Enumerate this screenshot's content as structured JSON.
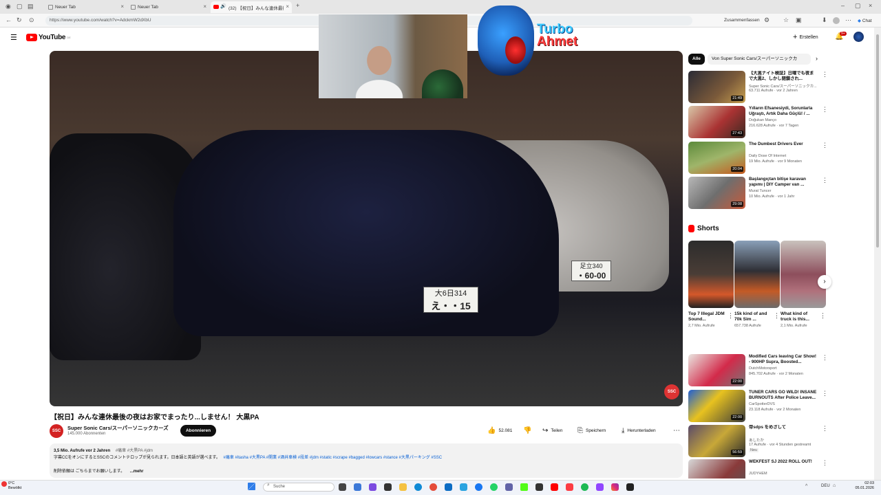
{
  "browser": {
    "tabs": [
      {
        "title": "Neuer Tab"
      },
      {
        "title": "Neuer Tab"
      },
      {
        "title": "(32) 【祝日】みんな連休最後の..."
      }
    ],
    "url": "https://www.youtube.com/watch?v=AdckmW2dXbU",
    "right_label": "Zusammenfassen",
    "chat_label": "Chat"
  },
  "youtube": {
    "logo_text": "YouTube",
    "logo_region": "DE",
    "create_label": "Erstellen",
    "notif_count": "9+",
    "video": {
      "title": "【祝日】みんな連休最後の夜はお家でまったり...しません！ 大黒PA",
      "plate1_line1": "大6日314",
      "plate1_line2": "え・・15",
      "plate2_line1": "足立340",
      "plate2_line2": "・60-00",
      "watermark": "SSC"
    },
    "channel": {
      "avatar_text": "SSC",
      "name": "Super Sonic Cars/スーパーソニックカーズ",
      "subscribers": "145.000 Abonnenten",
      "subscribe_label": "Abonnieren"
    },
    "actions": {
      "likes": "52.081",
      "share": "Teilen",
      "save": "Speichern",
      "download": "Herunterladen"
    },
    "description": {
      "stats": "3,5 Mio. Aufrufe  vor 2 Jahren",
      "stat_tags": "#痛車 #大黒PA #jdm",
      "line2": "字幕CCをオンにするとSSCのコメントテロップが見られます。日本語と英語が選べます。",
      "line2_tags": "#痛車 #itasha #大黒PA #開業 #酒井車検 #段差 #jdm #static #scrape #bagged #lowcars #stance #大黒パーキング #SSC",
      "line3": "削除依頼は ごちらまでお願いします。",
      "more": "...mehr"
    },
    "chips": [
      {
        "label": "Alle",
        "active": true
      },
      {
        "label": "Von Super Sonic Cars/スーパーソニックカ",
        "active": false
      }
    ],
    "related": [
      {
        "title": "【大黒ナイト検証】日曜でも夜まで大黒2、しかし閉鎖され...",
        "channel": "Super Sonic Cars/スーパーソニックカ...",
        "meta": "63.711 Aufrufe · vor 2 Jahren",
        "duration": "21:49"
      },
      {
        "title": "Yılların Efsanesiydi, Sorunlarla Uğraştı, Artık Daha Güçlü! / ...",
        "channel": "Doğukan Manço",
        "meta": "216.628 Aufrufe · vor 7 Tagen",
        "duration": "27:43"
      },
      {
        "title": "The Dumbest Drivers Ever",
        "channel": "Daily Dose Of Internet",
        "meta": "19 Mio. Aufrufe · vor 9 Monaten",
        "duration": "20:04"
      },
      {
        "title": "Başlangıçtan bitişe karavan yapımı | DIY Camper van ...",
        "channel": "Murat Tuncer",
        "meta": "10 Mio. Aufrufe · vor 1 Jahr",
        "duration": "29:08"
      }
    ],
    "shorts_heading": "Shorts",
    "shorts": [
      {
        "title": "Top 7 Illegal JDM Sound...",
        "views": "2,7 Mio. Aufrufe"
      },
      {
        "title": "15k kind of and 70k Sim ...",
        "views": "657.738 Aufrufe"
      },
      {
        "title": "What kind of truck is this...",
        "views": "2,1 Mio. Aufrufe"
      }
    ],
    "related2": [
      {
        "title": "Modified Cars leaving Car Show! - 900HP Supra, Boosted...",
        "channel": "DutchMotorsport",
        "meta": "845.702 Aufrufe · vor 2 Monaten",
        "duration": "22:00"
      },
      {
        "title": "TUNER CARS GO WILD! INSANE BURNOUTS After Police Leave...",
        "channel": "CarSpotterDVS",
        "meta": "23.118 Aufrufe · vor 2 Monaten",
        "duration": "22:00"
      },
      {
        "title": "帝sdps をめざして",
        "channel": "あしたか",
        "meta": "17 Aufrufe · vor 4 Stunden gestreamt",
        "duration": "56:59",
        "badge": "Neu"
      },
      {
        "title": "WEKFEST SJ 2022 ROLL OUT!",
        "channel": "JUDYHEM",
        "meta": "",
        "duration": ""
      }
    ]
  },
  "overlay": {
    "brand_line1": "Turbo",
    "brand_line2": "Ahmet"
  },
  "taskbar": {
    "weather_temp": "0°C",
    "weather_text": "Bewölkt",
    "search_placeholder": "Suche",
    "lang": "DEU",
    "time": "02:03",
    "date": "05.01.2026"
  }
}
